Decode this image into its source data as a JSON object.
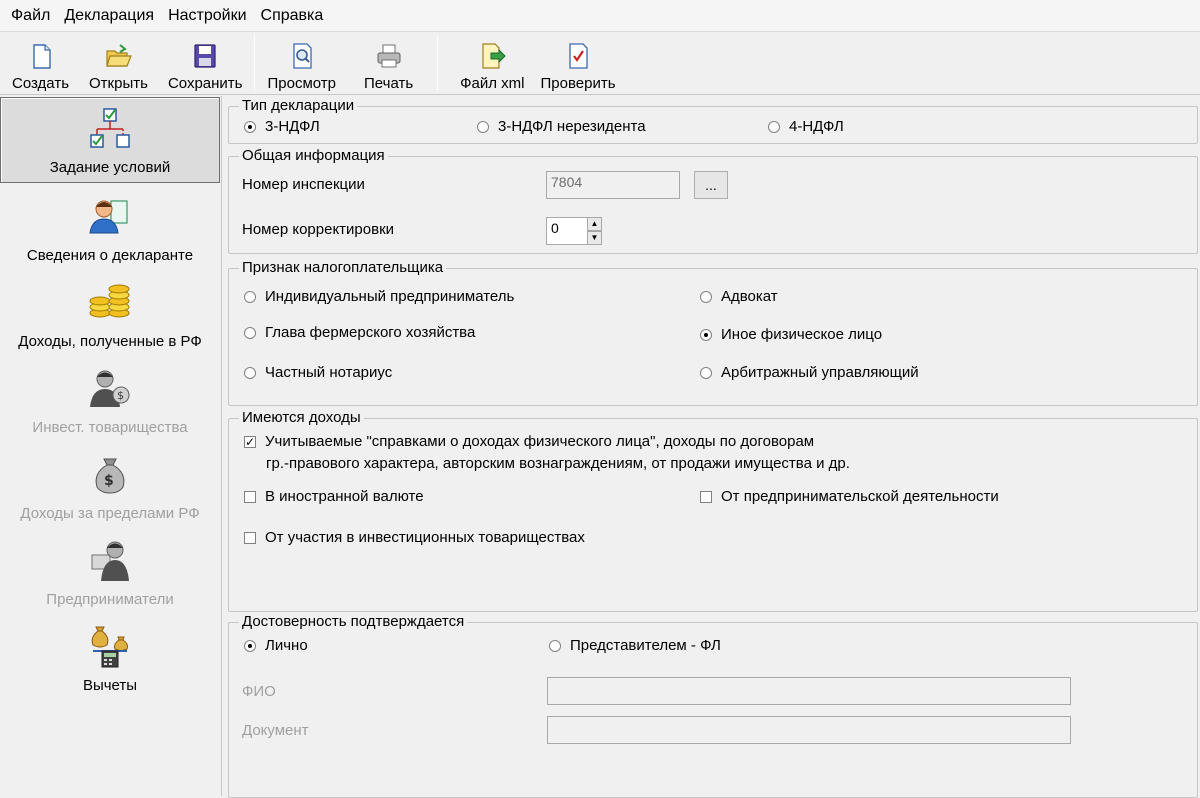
{
  "menu": [
    "Файл",
    "Декларация",
    "Настройки",
    "Справка"
  ],
  "toolbar": {
    "create": "Создать",
    "open": "Открыть",
    "save": "Сохранить",
    "preview": "Просмотр",
    "print": "Печать",
    "xml": "Файл xml",
    "check": "Проверить"
  },
  "nav": {
    "conditions": "Задание условий",
    "declarant": "Сведения о декларанте",
    "income_rf": "Доходы, полученные в РФ",
    "invest": "Инвест. товарищества",
    "income_abroad": "Доходы за пределами РФ",
    "entrepreneurs": "Предприниматели",
    "deductions": "Вычеты"
  },
  "decl_type": {
    "title": "Тип декларации",
    "opt1": "3-НДФЛ",
    "opt2": "3-НДФЛ нерезидента",
    "opt3": "4-НДФЛ",
    "selected": "3-НДФЛ"
  },
  "general": {
    "title": "Общая информация",
    "inspection_label": "Номер инспекции",
    "inspection_value": "7804",
    "browse_label": "...",
    "correction_label": "Номер корректировки",
    "correction_value": "0"
  },
  "taxpayer": {
    "title": "Признак налогоплательщика",
    "ip": "Индивидуальный предприниматель",
    "lawyer": "Адвокат",
    "farmer": "Глава фермерского хозяйства",
    "other": "Иное физическое лицо",
    "notary": "Частный нотариус",
    "arbitration": "Арбитражный управляющий",
    "selected": "Иное физическое лицо"
  },
  "income": {
    "title": "Имеются доходы",
    "certified_line1": "Учитываемые \"справками о доходах физического лица\", доходы по договорам",
    "certified_line2": "гр.-правового характера, авторским вознаграждениям, от продажи имущества и др.",
    "foreign_currency": "В иностранной валюте",
    "business": "От предпринимательской деятельности",
    "invest": "От участия в инвестиционных товариществах",
    "checked": [
      "certified"
    ]
  },
  "confirm": {
    "title": "Достоверность подтверждается",
    "personal": "Лично",
    "representative": "Представителем - ФЛ",
    "selected": "Лично",
    "fio_label": "ФИО",
    "doc_label": "Документ"
  }
}
